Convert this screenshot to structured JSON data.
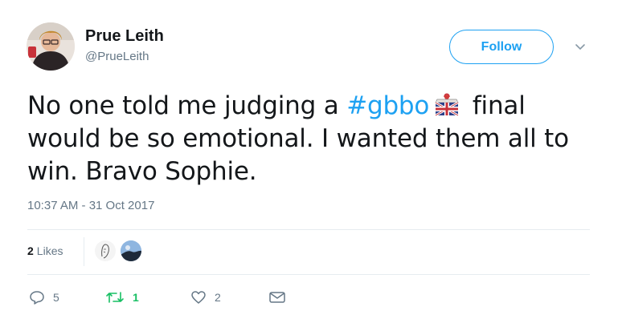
{
  "author": {
    "name": "Prue Leith",
    "handle": "@PrueLeith"
  },
  "follow_label": "Follow",
  "tweet": {
    "text_before": "No one told me judging a ",
    "hashtag": "#gbbo",
    "hashtag_emoji_icon": "gbbo-union-jack-cake-emoji-icon",
    "text_after": " final would be so emotional. I wanted them all to win. Bravo Sophie.",
    "timestamp": "10:37 AM - 31 Oct 2017"
  },
  "stats": {
    "likes_count": "2",
    "likes_label": "Likes"
  },
  "actions": {
    "reply_count": "5",
    "retweet_count": "1",
    "like_count": "2"
  },
  "colors": {
    "accent": "#1da1f2",
    "retweet": "#17bf63",
    "muted": "#657786",
    "text": "#14171a",
    "divider": "#e6ecf0"
  }
}
